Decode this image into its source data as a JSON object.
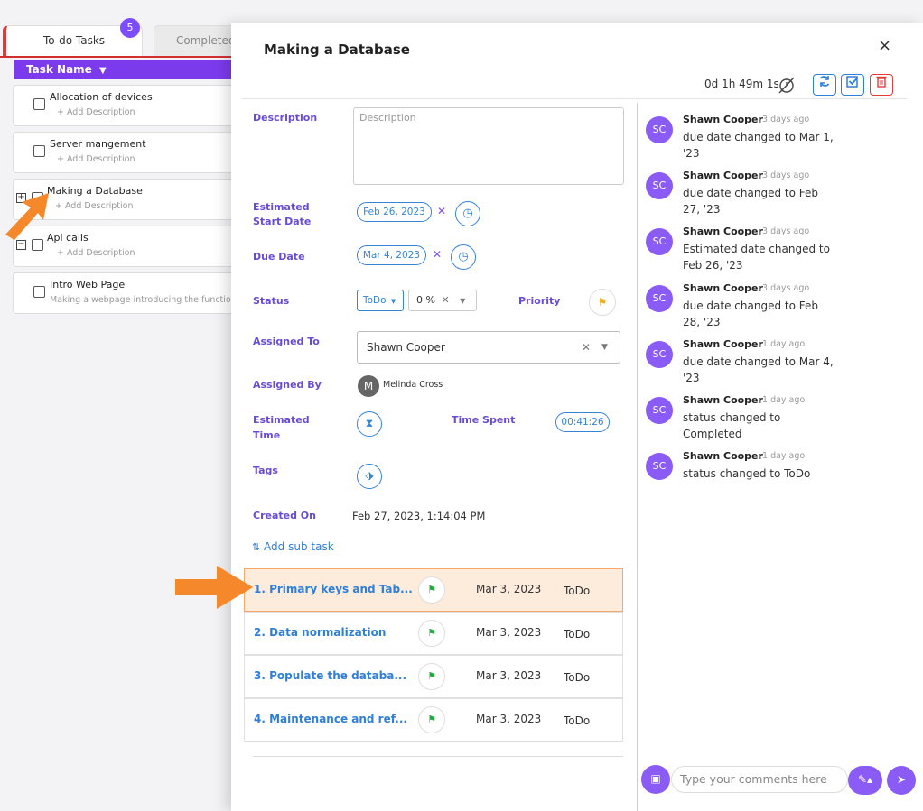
{
  "tabs": [
    {
      "label": "To-do Tasks",
      "badge": "5"
    },
    {
      "label": "Completed"
    }
  ],
  "list": {
    "header": "Task Name",
    "items": [
      {
        "title": "Allocation of devices",
        "desc": "+ Add Description"
      },
      {
        "title": "Server mangement",
        "desc": "+ Add Description"
      },
      {
        "title": "Making a Database",
        "desc": "+ Add Description"
      },
      {
        "title": "Api calls",
        "desc": "+ Add Description"
      },
      {
        "title": "Intro Web Page",
        "desc": "Making a webpage introducing the functio"
      }
    ]
  },
  "modal": {
    "title": "Making a Database",
    "close": "×",
    "timer": "0d 1h 49m 1s",
    "labels": {
      "description": "Description",
      "est_start_1": "Estimated",
      "est_start_2": "Start Date",
      "due": "Due Date",
      "status": "Status",
      "priority": "Priority",
      "assigned_to": "Assigned To",
      "assigned_by": "Assigned By",
      "est_time_1": "Estimated",
      "est_time_2": "Time",
      "time_spent": "Time Spent",
      "tags": "Tags",
      "created_on": "Created On"
    },
    "description_placeholder": "Description",
    "start_date": "Feb 26, 2023",
    "due_date": "Mar 4, 2023",
    "status": "ToDo",
    "progress": "0 %",
    "assigned_to": "Shawn Cooper",
    "assigned_by": {
      "initial": "M",
      "name": "Melinda Cross"
    },
    "time_spent": "00:41:26",
    "created_on": "Feb 27, 2023, 1:14:04 PM",
    "add_subtask": "Add sub task",
    "subtasks": [
      {
        "name": "1. Primary keys and Tab...",
        "date": "Mar 3, 2023",
        "status": "ToDo"
      },
      {
        "name": "2. Data normalization",
        "date": "Mar 3, 2023",
        "status": "ToDo"
      },
      {
        "name": "3. Populate the databa...",
        "date": "Mar 3, 2023",
        "status": "ToDo"
      },
      {
        "name": "4. Maintenance and ref...",
        "date": "Mar 3, 2023",
        "status": "ToDo"
      }
    ],
    "activity": [
      {
        "initials": "SC",
        "user": "Shawn Cooper",
        "time": "3 days ago",
        "l1": "due date changed to Mar 1,",
        "l2": "'23"
      },
      {
        "initials": "SC",
        "user": "Shawn Cooper",
        "time": "3 days ago",
        "l1": "due date changed to Feb",
        "l2": "27, '23"
      },
      {
        "initials": "SC",
        "user": "Shawn Cooper",
        "time": "3 days ago",
        "l1": "Estimated date changed to",
        "l2": "Feb 26, '23"
      },
      {
        "initials": "SC",
        "user": "Shawn Cooper",
        "time": "3 days ago",
        "l1": "due date changed to Feb",
        "l2": "28, '23"
      },
      {
        "initials": "SC",
        "user": "Shawn Cooper",
        "time": "1 day ago",
        "l1": "due date changed to Mar 4,",
        "l2": "'23"
      },
      {
        "initials": "SC",
        "user": "Shawn Cooper",
        "time": "1 day ago",
        "l1": "status changed to",
        "l2": "Completed"
      },
      {
        "initials": "SC",
        "user": "Shawn Cooper",
        "time": "1 day ago",
        "l1": "status changed to ToDo",
        "l2": ""
      }
    ],
    "comment_placeholder": "Type your comments here"
  }
}
